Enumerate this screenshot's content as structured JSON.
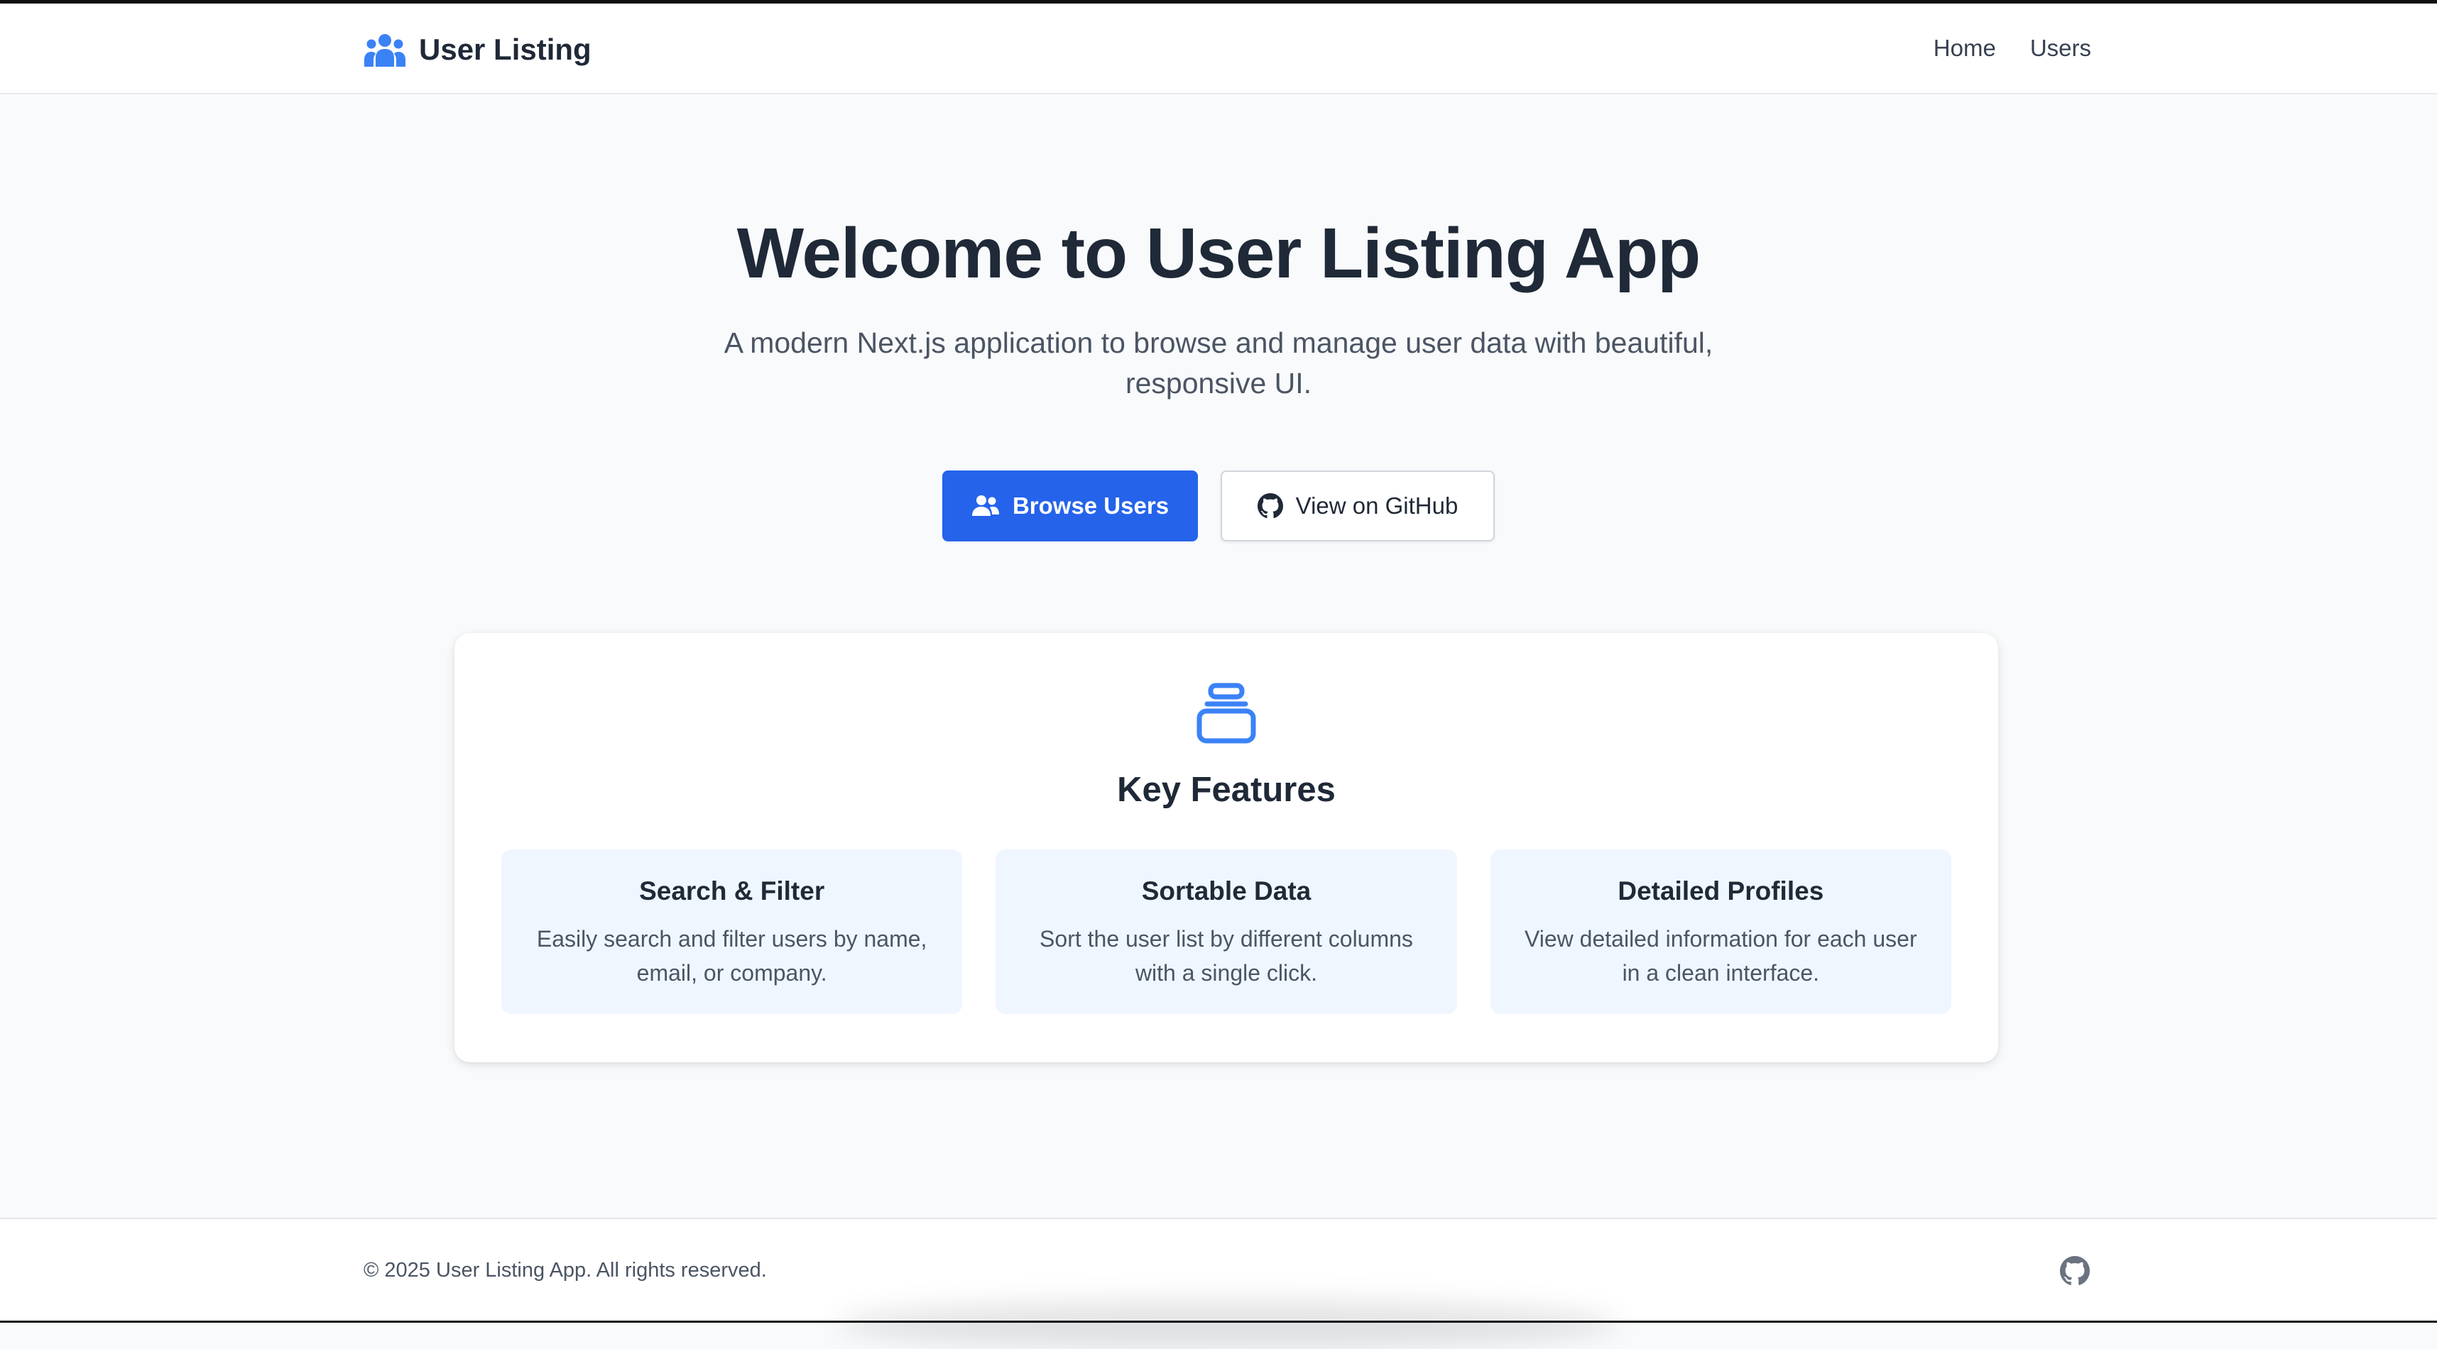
{
  "header": {
    "brand_title": "User Listing",
    "brand_icon": "users-icon",
    "nav": [
      {
        "label": "Home"
      },
      {
        "label": "Users"
      }
    ]
  },
  "hero": {
    "title": "Welcome to User Listing App",
    "subtitle": "A modern Next.js application to browse and manage user data with beautiful, responsive UI.",
    "primary_button": {
      "label": "Browse Users",
      "icon": "users-icon"
    },
    "secondary_button": {
      "label": "View on GitHub",
      "icon": "github-icon"
    }
  },
  "features": {
    "icon": "database-icon",
    "title": "Key Features",
    "items": [
      {
        "title": "Search & Filter",
        "description": "Easily search and filter users by name, email, or company."
      },
      {
        "title": "Sortable Data",
        "description": "Sort the user list by different columns with a single click."
      },
      {
        "title": "Detailed Profiles",
        "description": "View detailed information for each user in a clean interface."
      }
    ]
  },
  "footer": {
    "copyright": "© 2025 User Listing App. All rights reserved.",
    "github_icon": "github-icon"
  },
  "colors": {
    "accent": "#2563eb",
    "icon_blue": "#3b82f6",
    "background": "#f8fafc",
    "feature_bg": "#eff6ff",
    "text_dark": "#1f2937",
    "text_muted": "#4b5563"
  }
}
